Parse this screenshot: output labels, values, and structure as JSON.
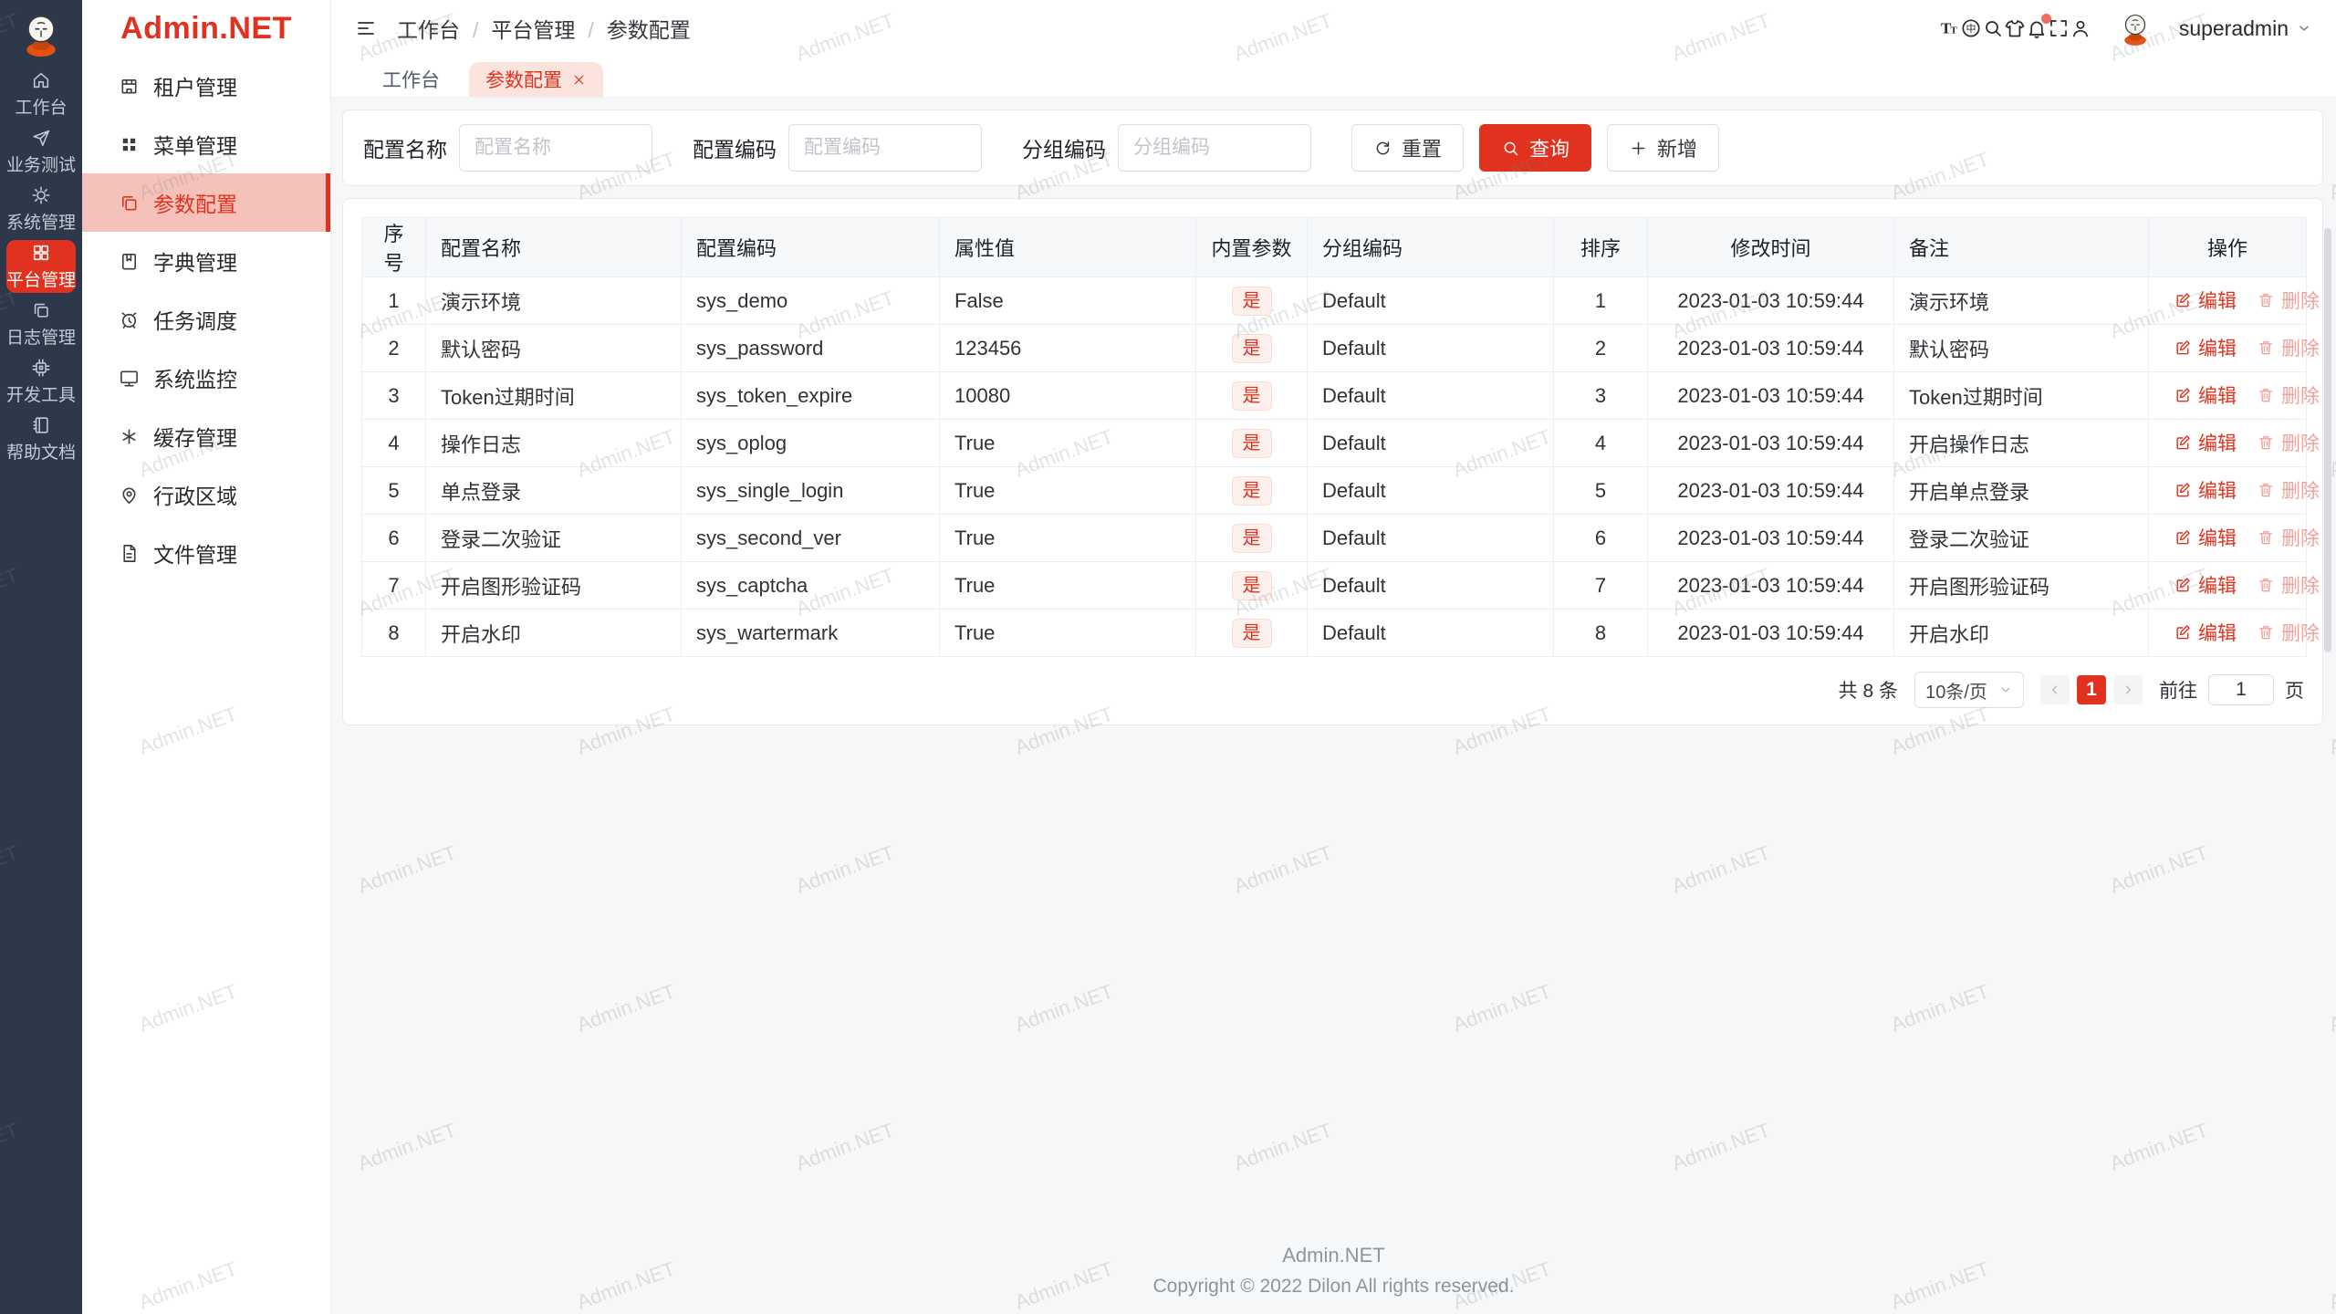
{
  "brand": {
    "name": "Admin.NET"
  },
  "colors": {
    "accent": "#e1321f",
    "rail_bg": "#2d394b",
    "active_menu_bg": "#f5c2ba",
    "tab_pill": "#fbe3de",
    "mascot_orange": "#e8500f"
  },
  "rail": {
    "items": [
      {
        "label": "工作台",
        "icon": "#i-home",
        "active": false
      },
      {
        "label": "业务测试",
        "icon": "#i-send",
        "active": false
      },
      {
        "label": "系统管理",
        "icon": "#i-gear",
        "active": false
      },
      {
        "label": "平台管理",
        "icon": "#i-grid",
        "active": true
      },
      {
        "label": "日志管理",
        "icon": "#i-copy",
        "active": false
      },
      {
        "label": "开发工具",
        "icon": "#i-chip",
        "active": false
      },
      {
        "label": "帮助文档",
        "icon": "#i-notebook",
        "active": false
      }
    ]
  },
  "sidebar": {
    "items": [
      {
        "label": "租户管理",
        "icon": "#i-tenant",
        "active": false
      },
      {
        "label": "菜单管理",
        "icon": "#i-menugrid",
        "active": false
      },
      {
        "label": "参数配置",
        "icon": "#i-copy",
        "active": true
      },
      {
        "label": "字典管理",
        "icon": "#i-dict",
        "active": false
      },
      {
        "label": "任务调度",
        "icon": "#i-clock",
        "active": false
      },
      {
        "label": "系统监控",
        "icon": "#i-monitor",
        "active": false
      },
      {
        "label": "缓存管理",
        "icon": "#i-snow",
        "active": false
      },
      {
        "label": "行政区域",
        "icon": "#i-pin",
        "active": false
      },
      {
        "label": "文件管理",
        "icon": "#i-file",
        "active": false
      }
    ]
  },
  "header": {
    "breadcrumb": [
      "工作台",
      "平台管理",
      "参数配置"
    ],
    "breadcrumb_separator": "/",
    "icons": [
      {
        "name": "font-size-icon",
        "icon": "#i-fontsize",
        "badge": false
      },
      {
        "name": "language-icon",
        "icon": "#i-lang",
        "badge": false
      },
      {
        "name": "search-icon",
        "icon": "#i-search",
        "badge": false
      },
      {
        "name": "theme-icon",
        "icon": "#i-shirt",
        "badge": false
      },
      {
        "name": "notification-icon",
        "icon": "#i-bell",
        "badge": true
      },
      {
        "name": "fullscreen-icon",
        "icon": "#i-full",
        "badge": false
      },
      {
        "name": "profile-icon",
        "icon": "#i-person",
        "badge": false
      }
    ],
    "user": "superadmin"
  },
  "tabs": [
    {
      "label": "工作台",
      "active": false,
      "closable": false
    },
    {
      "label": "参数配置",
      "active": true,
      "closable": true
    }
  ],
  "filters": [
    {
      "label": "配置名称",
      "placeholder": "配置名称"
    },
    {
      "label": "配置编码",
      "placeholder": "配置编码"
    },
    {
      "label": "分组编码",
      "placeholder": "分组编码"
    }
  ],
  "toolbar": {
    "reset_label": "重置",
    "search_label": "查询",
    "add_label": "新增"
  },
  "table": {
    "columns": [
      "序号",
      "配置名称",
      "配置编码",
      "属性值",
      "内置参数",
      "分组编码",
      "排序",
      "修改时间",
      "备注",
      "操作"
    ],
    "edit_label": "编辑",
    "delete_label": "删除",
    "rows": [
      {
        "num": "1",
        "name": "演示环境",
        "code": "sys_demo",
        "value": "False",
        "builtin": "是",
        "group": "Default",
        "order": "1",
        "time": "2023-01-03 10:59:44",
        "remark": "演示环境"
      },
      {
        "num": "2",
        "name": "默认密码",
        "code": "sys_password",
        "value": "123456",
        "builtin": "是",
        "group": "Default",
        "order": "2",
        "time": "2023-01-03 10:59:44",
        "remark": "默认密码"
      },
      {
        "num": "3",
        "name": "Token过期时间",
        "code": "sys_token_expire",
        "value": "10080",
        "builtin": "是",
        "group": "Default",
        "order": "3",
        "time": "2023-01-03 10:59:44",
        "remark": "Token过期时间"
      },
      {
        "num": "4",
        "name": "操作日志",
        "code": "sys_oplog",
        "value": "True",
        "builtin": "是",
        "group": "Default",
        "order": "4",
        "time": "2023-01-03 10:59:44",
        "remark": "开启操作日志"
      },
      {
        "num": "5",
        "name": "单点登录",
        "code": "sys_single_login",
        "value": "True",
        "builtin": "是",
        "group": "Default",
        "order": "5",
        "time": "2023-01-03 10:59:44",
        "remark": "开启单点登录"
      },
      {
        "num": "6",
        "name": "登录二次验证",
        "code": "sys_second_ver",
        "value": "True",
        "builtin": "是",
        "group": "Default",
        "order": "6",
        "time": "2023-01-03 10:59:44",
        "remark": "登录二次验证"
      },
      {
        "num": "7",
        "name": "开启图形验证码",
        "code": "sys_captcha",
        "value": "True",
        "builtin": "是",
        "group": "Default",
        "order": "7",
        "time": "2023-01-03 10:59:44",
        "remark": "开启图形验证码"
      },
      {
        "num": "8",
        "name": "开启水印",
        "code": "sys_wartermark",
        "value": "True",
        "builtin": "是",
        "group": "Default",
        "order": "8",
        "time": "2023-01-03 10:59:44",
        "remark": "开启水印"
      }
    ]
  },
  "pagination": {
    "total": "共 8 条",
    "page_size": "10条/页",
    "current_page": "1",
    "goto_label": "前往",
    "goto_value": "1",
    "page_unit": "页"
  },
  "footer": {
    "title": "Admin.NET",
    "copyright": "Copyright © 2022 Dilon All rights reserved."
  },
  "watermark": {
    "text": "Admin.NET"
  }
}
